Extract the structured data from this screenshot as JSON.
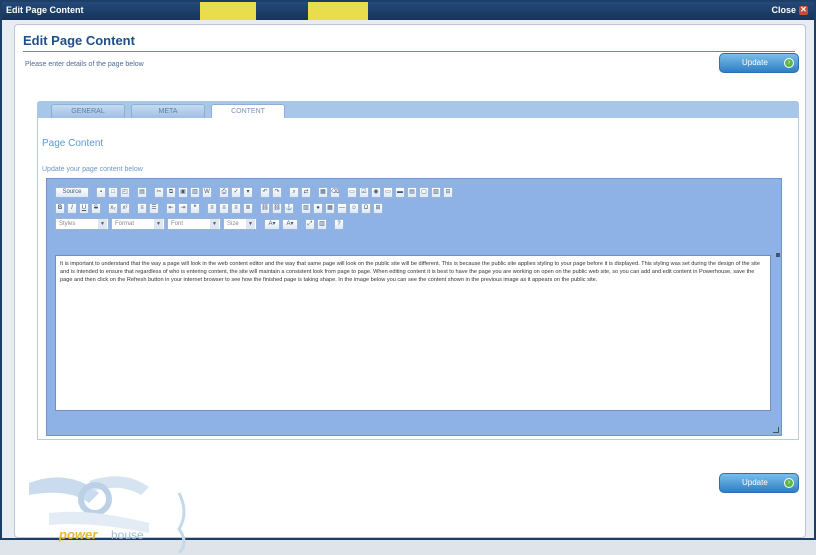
{
  "titlebar": {
    "title": "Edit Page Content",
    "close_label": "Close"
  },
  "header": {
    "title": "Edit Page Content",
    "instructions": "Please enter details of the page below"
  },
  "buttons": {
    "update_top": "Update",
    "update_bottom": "Update"
  },
  "tabs": [
    {
      "label": "GENERAL"
    },
    {
      "label": "META"
    },
    {
      "label": "CONTENT"
    }
  ],
  "section": {
    "title": "Page Content",
    "instructions": "Update your page content below"
  },
  "editor": {
    "source_label": "Source",
    "selects": {
      "styles": "Styles",
      "format": "Format",
      "font": "Font",
      "size": "Size"
    },
    "body": "It is important to understand that the way a page will look in the web content editor and the way that same page will look on the public site will be different. This is because the public site applies styling to your page before it is displayed. This styling was set during the design of the site and is intended to ensure that regardless of who is entering content, the site will maintain a consistent look from page to page. When editing content it is best to have the page you are working on open on the public web site, so you can add and edit content in Powerhouse, save the page and then click on the Refresh button in your internet browser to see how the finished page is taking shape. In the image below you can see the content shown in the previous image as it appears on the public site."
  },
  "logo": {
    "word1": "power",
    "word2": "house"
  },
  "colors": {
    "titlebar": "#1d3f66",
    "accent": "#1e4f88",
    "editor_bg": "#8eb2e6",
    "button": "#2e7fc4"
  }
}
